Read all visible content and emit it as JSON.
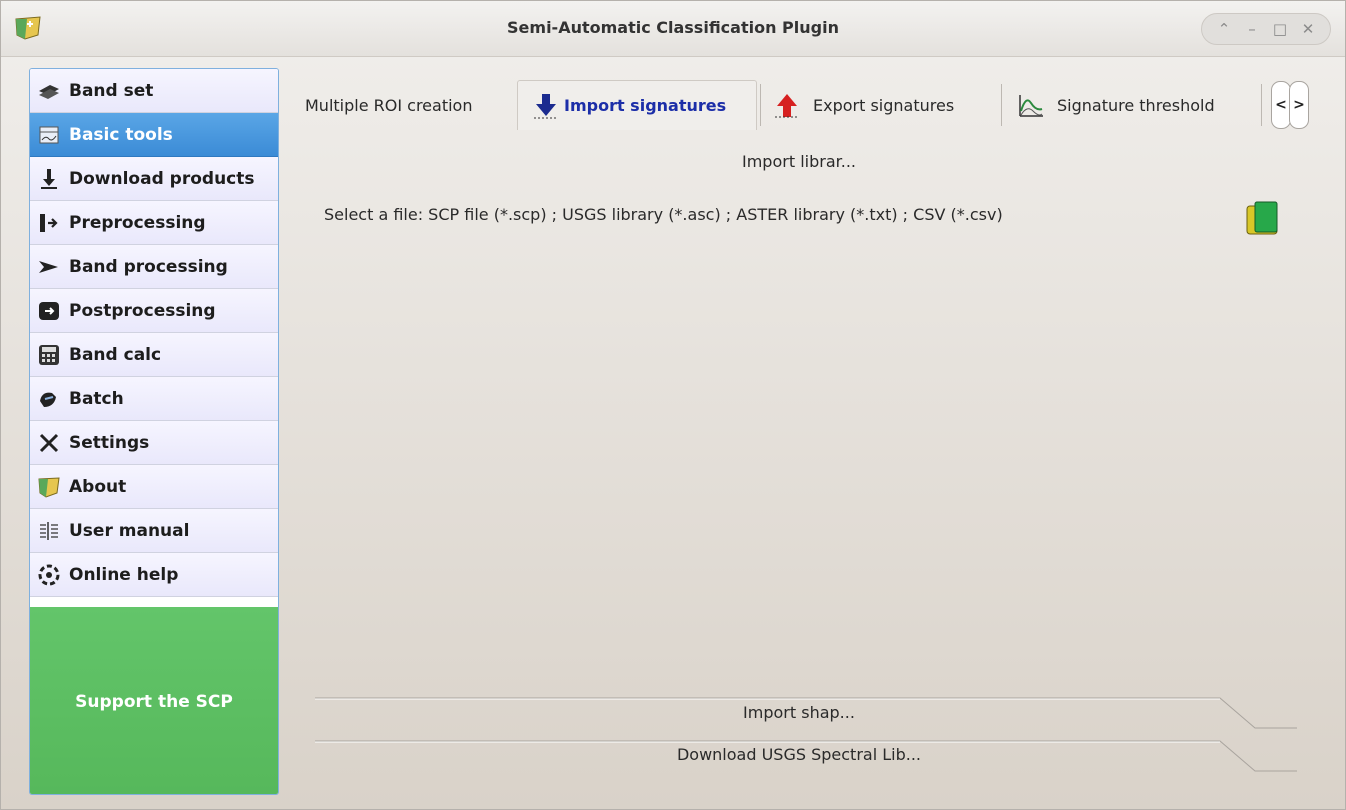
{
  "window": {
    "title": "Semi-Automatic Classification Plugin",
    "controls": [
      "⌃",
      "–",
      "□",
      "✕"
    ]
  },
  "sidebar": {
    "items": [
      {
        "label": "Band set",
        "icon": "band-set-icon",
        "active": false
      },
      {
        "label": "Basic tools",
        "icon": "basic-tools-icon",
        "active": true
      },
      {
        "label": "Download products",
        "icon": "download-icon",
        "active": false
      },
      {
        "label": "Preprocessing",
        "icon": "preprocessing-icon",
        "active": false
      },
      {
        "label": "Band processing",
        "icon": "band-processing-icon",
        "active": false
      },
      {
        "label": "Postprocessing",
        "icon": "postprocessing-icon",
        "active": false
      },
      {
        "label": "Band calc",
        "icon": "calculator-icon",
        "active": false
      },
      {
        "label": "Batch",
        "icon": "batch-icon",
        "active": false
      },
      {
        "label": "Settings",
        "icon": "settings-icon",
        "active": false
      },
      {
        "label": "About",
        "icon": "about-icon",
        "active": false
      },
      {
        "label": "User manual",
        "icon": "manual-icon",
        "active": false
      },
      {
        "label": "Online help",
        "icon": "help-icon",
        "active": false
      }
    ],
    "support_label": "Support the SCP"
  },
  "tabs": [
    {
      "label": "Multiple ROI creation",
      "active": false
    },
    {
      "label": "Import signatures",
      "active": true
    },
    {
      "label": "Export signatures",
      "active": false
    },
    {
      "label": "Signature threshold",
      "active": false
    }
  ],
  "tab_scroll": {
    "left": "<",
    "right": ">"
  },
  "main": {
    "import_library_header": "Import librar...",
    "file_select_label": "Select a file: SCP file (*.scp) ; USGS library (*.asc) ; ASTER library (*.txt) ; CSV (*.csv)",
    "import_shapefile_header": "Import shap...",
    "download_usgs_header": "Download USGS Spectral Lib..."
  },
  "colors": {
    "active_nav": "#4a98de",
    "support_green": "#5dbf63",
    "active_tab_text": "#1c2ea8"
  }
}
